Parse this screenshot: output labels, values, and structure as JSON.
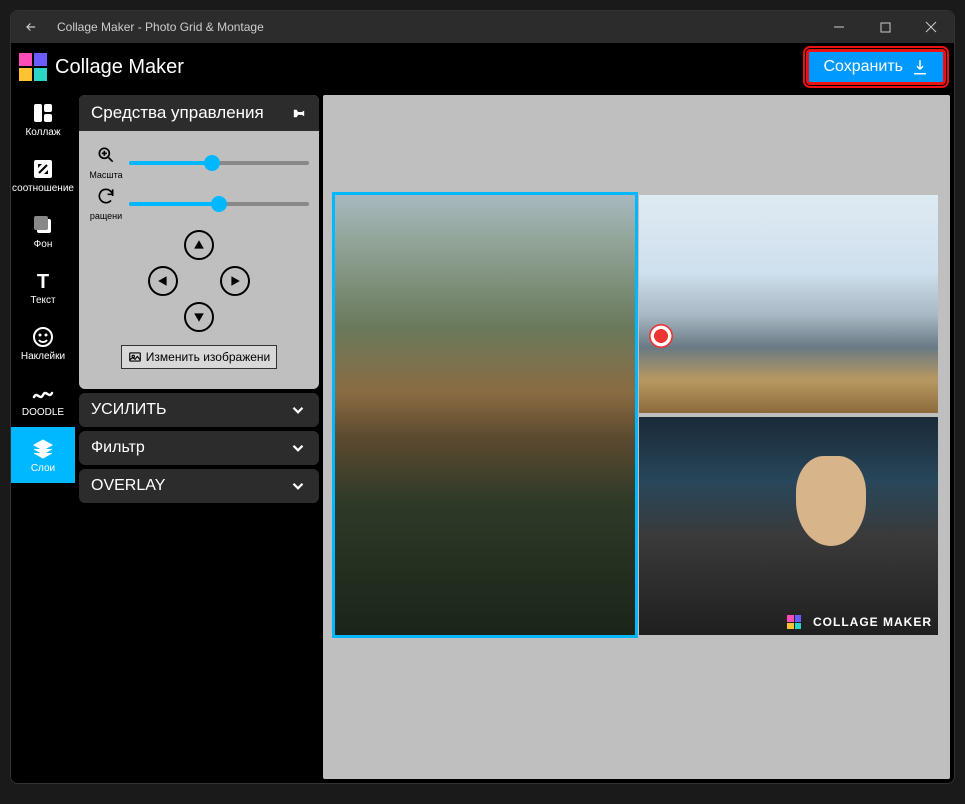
{
  "titlebar": {
    "title": "Collage Maker - Photo Grid & Montage"
  },
  "appbar": {
    "title": "Collage Maker",
    "save_label": "Сохранить"
  },
  "sidebar": {
    "items": [
      {
        "label": "Коллаж"
      },
      {
        "label": "соотношение"
      },
      {
        "label": "Фон"
      },
      {
        "label": "Текст"
      },
      {
        "label": "Наклейки"
      },
      {
        "label": "DOODLE"
      },
      {
        "label": "Слои"
      }
    ]
  },
  "controls": {
    "title": "Средства управления",
    "zoom_label": "Масшта",
    "rotate_label": "ращени",
    "zoom_pct": 46,
    "rotate_pct": 50,
    "change_label": "Изменить изображени"
  },
  "accordions": [
    {
      "label": "УСИЛИТЬ"
    },
    {
      "label": "Фильтр"
    },
    {
      "label": "OVERLAY"
    }
  ],
  "watermark": "COLLAGE MAKER"
}
